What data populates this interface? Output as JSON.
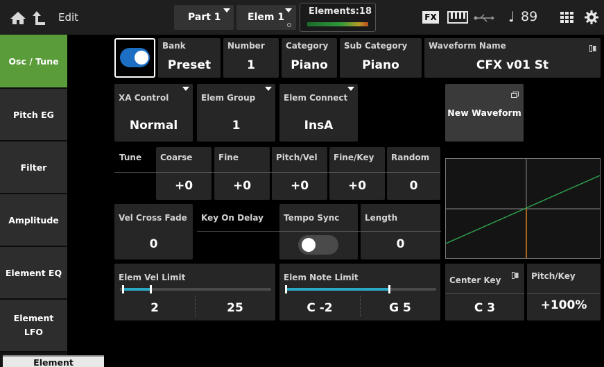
{
  "topbar": {
    "home_icon": "home-icon",
    "up_icon": "up-arrow-icon",
    "edit_label": "Edit",
    "part_tab": "Part 1",
    "elem_tab": "Elem 1",
    "elements_label": "Elements:18",
    "fx_label": "FX",
    "tempo_note": "♩",
    "tempo": "89"
  },
  "sidebar": {
    "items": [
      {
        "label": "Osc / Tune"
      },
      {
        "label": "Pitch EG"
      },
      {
        "label": "Filter"
      },
      {
        "label": "Amplitude"
      },
      {
        "label": "Element EQ"
      },
      {
        "label": "Element LFO"
      }
    ],
    "bottom_label": "Element"
  },
  "row1": {
    "bank_label": "Bank",
    "bank_value": "Preset",
    "number_label": "Number",
    "number_value": "1",
    "category_label": "Category",
    "category_value": "Piano",
    "subcat_label": "Sub Category",
    "subcat_value": "Piano",
    "waveform_label": "Waveform Name",
    "waveform_value": "CFX v01 St"
  },
  "row2": {
    "xa_label": "XA Control",
    "xa_value": "Normal",
    "group_label": "Elem Group",
    "group_value": "1",
    "connect_label": "Elem Connect",
    "connect_value": "InsA",
    "new_waveform_label": "New Waveform"
  },
  "tune": {
    "tune_label": "Tune",
    "coarse_label": "Coarse",
    "coarse_value": "+0",
    "fine_label": "Fine",
    "fine_value": "+0",
    "pitchvel_label": "Pitch/Vel",
    "pitchvel_value": "+0",
    "finekey_label": "Fine/Key",
    "finekey_value": "+0",
    "random_label": "Random",
    "random_value": "0"
  },
  "row4": {
    "velcf_label": "Vel Cross Fade",
    "velcf_value": "0",
    "keydelay_label": "Key On Delay",
    "temposync_label": "Tempo Sync",
    "length_label": "Length",
    "length_value": "0"
  },
  "limits": {
    "vel_label": "Elem Vel Limit",
    "vel_low": "2",
    "vel_high": "25",
    "vel_low_fraction": 0.016,
    "vel_high_fraction": 0.197,
    "note_label": "Elem Note Limit",
    "note_low": "C -2",
    "note_high": "G 5",
    "note_low_fraction": 0.0,
    "note_high_fraction": 0.685,
    "center_key_label": "Center Key",
    "center_key_value": "C 3",
    "pitchkey_label": "Pitch/Key",
    "pitchkey_value": "+100%"
  },
  "colors": {
    "accent_green": "#5a9c3a",
    "toggle_on": "#1d6fc4",
    "slider_fill": "#2aa9c4",
    "graph_line": "#2e9e4e",
    "graph_marker": "#d9801e"
  }
}
